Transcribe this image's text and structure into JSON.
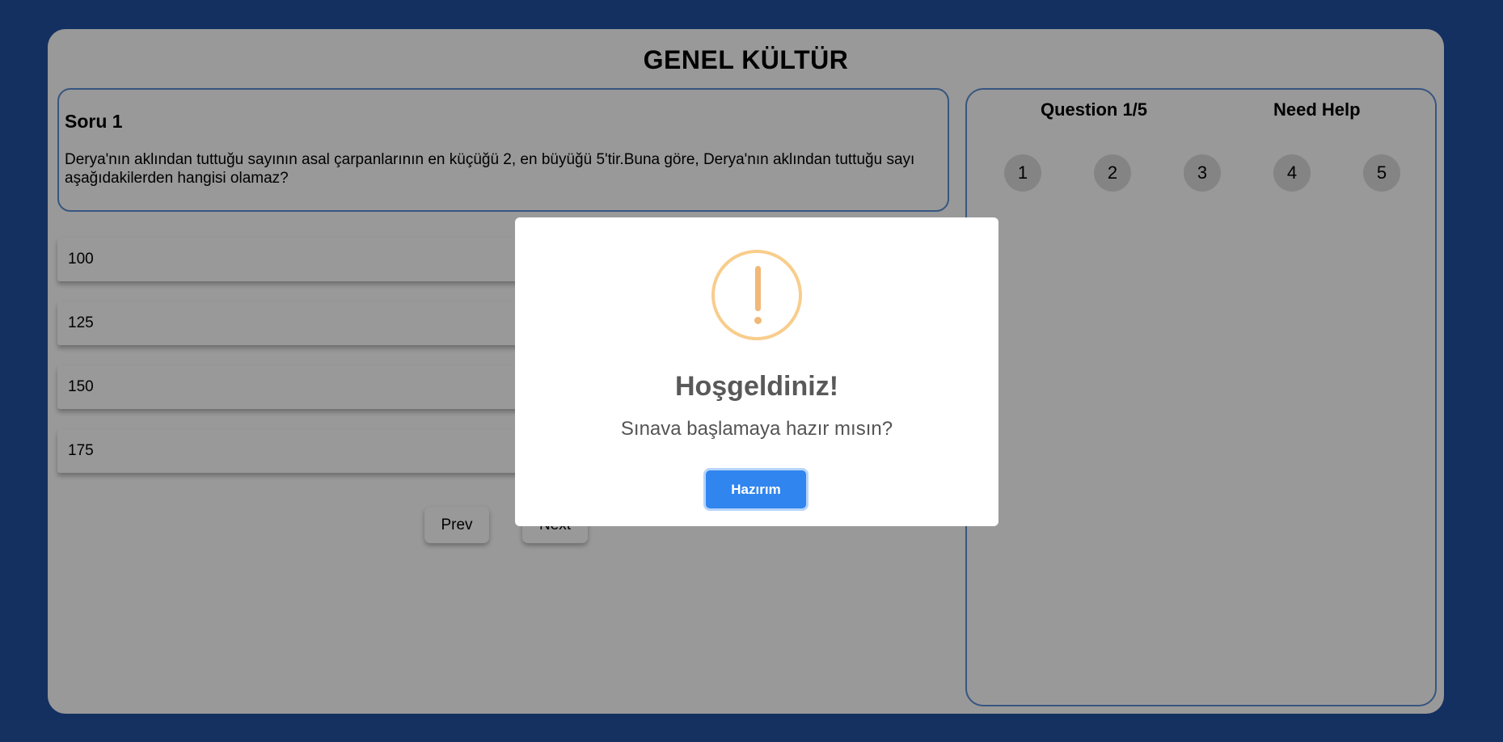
{
  "app": {
    "title": "GENEL KÜLTÜR"
  },
  "question": {
    "heading": "Soru 1",
    "text": "Derya'nın aklından tuttuğu sayının asal çarpanlarının en küçüğü 2, en büyüğü 5'tir.Buna göre, Derya'nın aklından tuttuğu sayı aşağıdakilerden hangisi olamaz?"
  },
  "options": [
    {
      "label": "100"
    },
    {
      "label": "125"
    },
    {
      "label": "150"
    },
    {
      "label": "175"
    }
  ],
  "nav": {
    "prev_label": "Prev",
    "next_label": "Next"
  },
  "sidebar": {
    "progress_label": "Question 1/5",
    "help_label": "Need Help",
    "numbers": [
      "1",
      "2",
      "3",
      "4",
      "5"
    ]
  },
  "modal": {
    "icon": "warning-icon",
    "title": "Hoşgeldiniz!",
    "text": "Sınava başlamaya hazır mısın?",
    "confirm_label": "Hazırım"
  },
  "colors": {
    "background": "#2151a0",
    "border_accent": "#5b8fd6",
    "confirm_button": "#3085ee",
    "warning": "#f8cd8c"
  }
}
